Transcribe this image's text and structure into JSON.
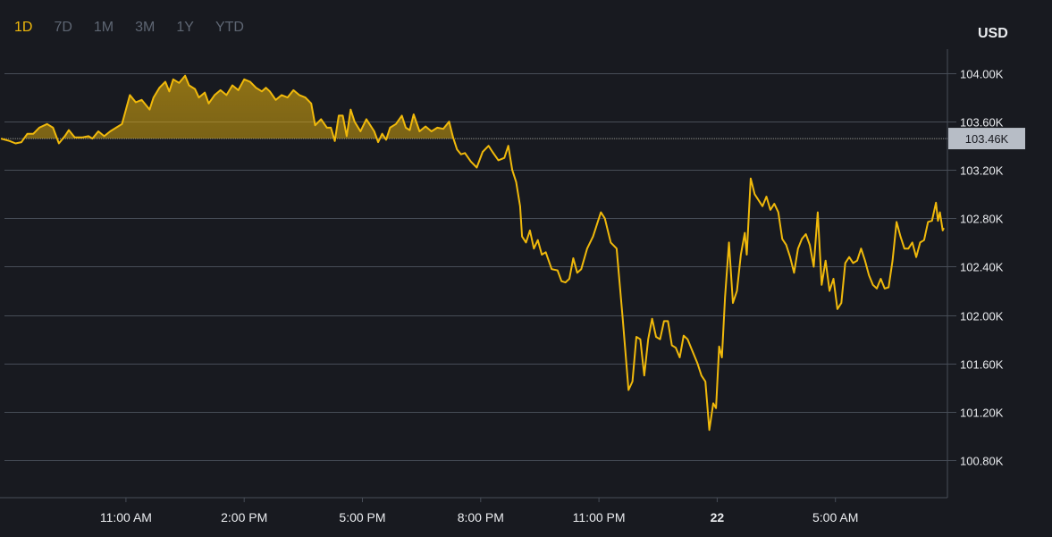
{
  "range_tabs": [
    {
      "label": "1D",
      "active": true
    },
    {
      "label": "7D",
      "active": false
    },
    {
      "label": "1M",
      "active": false
    },
    {
      "label": "3M",
      "active": false
    },
    {
      "label": "1Y",
      "active": false
    },
    {
      "label": "YTD",
      "active": false
    }
  ],
  "currency": "USD",
  "colors": {
    "background": "#181a20",
    "line": "#f0b90b",
    "grid": "#474d57",
    "axis_text": "#eaecef",
    "current_price_badge": "#b7bdc6"
  },
  "chart_data": {
    "type": "area",
    "x_unit": "hours since 8:00 AM",
    "x_ticks": [
      {
        "x": 3,
        "label": "11:00 AM"
      },
      {
        "x": 6,
        "label": "2:00 PM"
      },
      {
        "x": 9,
        "label": "5:00 PM"
      },
      {
        "x": 12,
        "label": "8:00 PM"
      },
      {
        "x": 15,
        "label": "11:00 PM"
      },
      {
        "x": 18,
        "label": "22"
      },
      {
        "x": 21,
        "label": "5:00 AM"
      }
    ],
    "y_ticks": [
      {
        "value": 104.0,
        "label": "104.00K"
      },
      {
        "value": 103.6,
        "label": "103.60K"
      },
      {
        "value": 103.2,
        "label": "103.20K"
      },
      {
        "value": 102.8,
        "label": "102.80K"
      },
      {
        "value": 102.4,
        "label": "102.40K"
      },
      {
        "value": 102.0,
        "label": "102.00K"
      },
      {
        "value": 101.6,
        "label": "101.60K"
      },
      {
        "value": 101.2,
        "label": "101.20K"
      },
      {
        "value": 100.8,
        "label": "100.80K"
      }
    ],
    "reference_price": {
      "value": 103.46,
      "label": "103.46K"
    },
    "y_unit": "K USD",
    "ylim": [
      100.51,
      104.21
    ],
    "xlim": [
      -0.17,
      23.75
    ],
    "series": [
      {
        "points": [
          [
            -0.17,
            103.46
          ],
          [
            0.05,
            103.44
          ],
          [
            0.2,
            103.42
          ],
          [
            0.35,
            103.43
          ],
          [
            0.5,
            103.5
          ],
          [
            0.65,
            103.5
          ],
          [
            0.8,
            103.55
          ],
          [
            1.0,
            103.58
          ],
          [
            1.15,
            103.55
          ],
          [
            1.3,
            103.42
          ],
          [
            1.45,
            103.48
          ],
          [
            1.55,
            103.53
          ],
          [
            1.7,
            103.47
          ],
          [
            1.9,
            103.47
          ],
          [
            2.05,
            103.48
          ],
          [
            2.15,
            103.46
          ],
          [
            2.3,
            103.52
          ],
          [
            2.45,
            103.48
          ],
          [
            2.6,
            103.52
          ],
          [
            2.75,
            103.55
          ],
          [
            2.9,
            103.58
          ],
          [
            3.0,
            103.7
          ],
          [
            3.1,
            103.82
          ],
          [
            3.25,
            103.76
          ],
          [
            3.4,
            103.78
          ],
          [
            3.6,
            103.7
          ],
          [
            3.7,
            103.8
          ],
          [
            3.85,
            103.88
          ],
          [
            4.0,
            103.93
          ],
          [
            4.1,
            103.85
          ],
          [
            4.2,
            103.95
          ],
          [
            4.35,
            103.92
          ],
          [
            4.5,
            103.98
          ],
          [
            4.6,
            103.9
          ],
          [
            4.75,
            103.87
          ],
          [
            4.85,
            103.8
          ],
          [
            5.0,
            103.84
          ],
          [
            5.1,
            103.75
          ],
          [
            5.25,
            103.82
          ],
          [
            5.4,
            103.86
          ],
          [
            5.55,
            103.82
          ],
          [
            5.7,
            103.9
          ],
          [
            5.85,
            103.86
          ],
          [
            6.0,
            103.95
          ],
          [
            6.15,
            103.93
          ],
          [
            6.3,
            103.88
          ],
          [
            6.45,
            103.85
          ],
          [
            6.55,
            103.88
          ],
          [
            6.65,
            103.85
          ],
          [
            6.8,
            103.78
          ],
          [
            6.95,
            103.82
          ],
          [
            7.1,
            103.8
          ],
          [
            7.25,
            103.86
          ],
          [
            7.4,
            103.82
          ],
          [
            7.55,
            103.8
          ],
          [
            7.7,
            103.75
          ],
          [
            7.8,
            103.57
          ],
          [
            7.95,
            103.62
          ],
          [
            8.1,
            103.55
          ],
          [
            8.2,
            103.55
          ],
          [
            8.3,
            103.44
          ],
          [
            8.4,
            103.65
          ],
          [
            8.5,
            103.65
          ],
          [
            8.6,
            103.48
          ],
          [
            8.7,
            103.7
          ],
          [
            8.8,
            103.6
          ],
          [
            8.95,
            103.52
          ],
          [
            9.1,
            103.62
          ],
          [
            9.3,
            103.52
          ],
          [
            9.4,
            103.43
          ],
          [
            9.5,
            103.5
          ],
          [
            9.6,
            103.45
          ],
          [
            9.7,
            103.55
          ],
          [
            9.85,
            103.58
          ],
          [
            10.0,
            103.65
          ],
          [
            10.1,
            103.55
          ],
          [
            10.2,
            103.53
          ],
          [
            10.3,
            103.66
          ],
          [
            10.45,
            103.52
          ],
          [
            10.6,
            103.56
          ],
          [
            10.75,
            103.52
          ],
          [
            10.9,
            103.55
          ],
          [
            11.05,
            103.54
          ],
          [
            11.2,
            103.6
          ],
          [
            11.3,
            103.47
          ],
          [
            11.4,
            103.37
          ],
          [
            11.5,
            103.33
          ],
          [
            11.6,
            103.34
          ],
          [
            11.75,
            103.27
          ],
          [
            11.9,
            103.22
          ],
          [
            12.05,
            103.35
          ],
          [
            12.2,
            103.4
          ],
          [
            12.3,
            103.35
          ],
          [
            12.45,
            103.28
          ],
          [
            12.6,
            103.3
          ],
          [
            12.7,
            103.4
          ],
          [
            12.8,
            103.2
          ],
          [
            12.9,
            103.1
          ],
          [
            13.0,
            102.9
          ],
          [
            13.05,
            102.65
          ],
          [
            13.15,
            102.6
          ],
          [
            13.25,
            102.7
          ],
          [
            13.35,
            102.55
          ],
          [
            13.45,
            102.62
          ],
          [
            13.55,
            102.5
          ],
          [
            13.65,
            102.52
          ],
          [
            13.8,
            102.38
          ],
          [
            13.95,
            102.37
          ],
          [
            14.05,
            102.28
          ],
          [
            14.15,
            102.27
          ],
          [
            14.25,
            102.3
          ],
          [
            14.35,
            102.47
          ],
          [
            14.45,
            102.35
          ],
          [
            14.55,
            102.38
          ],
          [
            14.7,
            102.55
          ],
          [
            14.85,
            102.65
          ],
          [
            14.95,
            102.75
          ],
          [
            15.05,
            102.85
          ],
          [
            15.15,
            102.8
          ],
          [
            15.3,
            102.6
          ],
          [
            15.45,
            102.55
          ],
          [
            15.6,
            101.98
          ],
          [
            15.75,
            101.38
          ],
          [
            15.85,
            101.45
          ],
          [
            15.95,
            101.82
          ],
          [
            16.05,
            101.8
          ],
          [
            16.15,
            101.5
          ],
          [
            16.25,
            101.8
          ],
          [
            16.35,
            101.97
          ],
          [
            16.45,
            101.82
          ],
          [
            16.55,
            101.8
          ],
          [
            16.65,
            101.95
          ],
          [
            16.75,
            101.95
          ],
          [
            16.85,
            101.75
          ],
          [
            16.95,
            101.73
          ],
          [
            17.05,
            101.65
          ],
          [
            17.15,
            101.83
          ],
          [
            17.25,
            101.8
          ],
          [
            17.35,
            101.72
          ],
          [
            17.5,
            101.6
          ],
          [
            17.6,
            101.5
          ],
          [
            17.7,
            101.45
          ],
          [
            17.8,
            101.05
          ],
          [
            17.9,
            101.27
          ],
          [
            17.97,
            101.23
          ],
          [
            18.05,
            101.74
          ],
          [
            18.12,
            101.65
          ],
          [
            18.2,
            102.15
          ],
          [
            18.3,
            102.6
          ],
          [
            18.4,
            102.1
          ],
          [
            18.5,
            102.2
          ],
          [
            18.6,
            102.5
          ],
          [
            18.7,
            102.68
          ],
          [
            18.75,
            102.5
          ],
          [
            18.85,
            103.13
          ],
          [
            18.95,
            103.0
          ],
          [
            19.05,
            102.95
          ],
          [
            19.15,
            102.9
          ],
          [
            19.25,
            102.98
          ],
          [
            19.35,
            102.87
          ],
          [
            19.45,
            102.92
          ],
          [
            19.55,
            102.85
          ],
          [
            19.65,
            102.63
          ],
          [
            19.75,
            102.58
          ],
          [
            19.85,
            102.48
          ],
          [
            19.95,
            102.35
          ],
          [
            20.05,
            102.55
          ],
          [
            20.15,
            102.63
          ],
          [
            20.25,
            102.67
          ],
          [
            20.35,
            102.58
          ],
          [
            20.45,
            102.4
          ],
          [
            20.55,
            102.85
          ],
          [
            20.65,
            102.25
          ],
          [
            20.75,
            102.45
          ],
          [
            20.85,
            102.2
          ],
          [
            20.95,
            102.3
          ],
          [
            21.05,
            102.05
          ],
          [
            21.15,
            102.1
          ],
          [
            21.25,
            102.43
          ],
          [
            21.35,
            102.48
          ],
          [
            21.45,
            102.43
          ],
          [
            21.55,
            102.45
          ],
          [
            21.65,
            102.55
          ],
          [
            21.75,
            102.45
          ],
          [
            21.85,
            102.33
          ],
          [
            21.95,
            102.25
          ],
          [
            22.05,
            102.22
          ],
          [
            22.15,
            102.3
          ],
          [
            22.25,
            102.22
          ],
          [
            22.35,
            102.23
          ],
          [
            22.45,
            102.45
          ],
          [
            22.55,
            102.77
          ],
          [
            22.65,
            102.65
          ],
          [
            22.75,
            102.55
          ],
          [
            22.85,
            102.55
          ],
          [
            22.95,
            102.6
          ],
          [
            23.05,
            102.48
          ],
          [
            23.15,
            102.6
          ],
          [
            23.25,
            102.62
          ],
          [
            23.35,
            102.77
          ],
          [
            23.45,
            102.78
          ],
          [
            23.55,
            102.93
          ],
          [
            23.6,
            102.78
          ],
          [
            23.65,
            102.85
          ],
          [
            23.72,
            102.7
          ],
          [
            23.75,
            102.72
          ]
        ]
      }
    ]
  }
}
